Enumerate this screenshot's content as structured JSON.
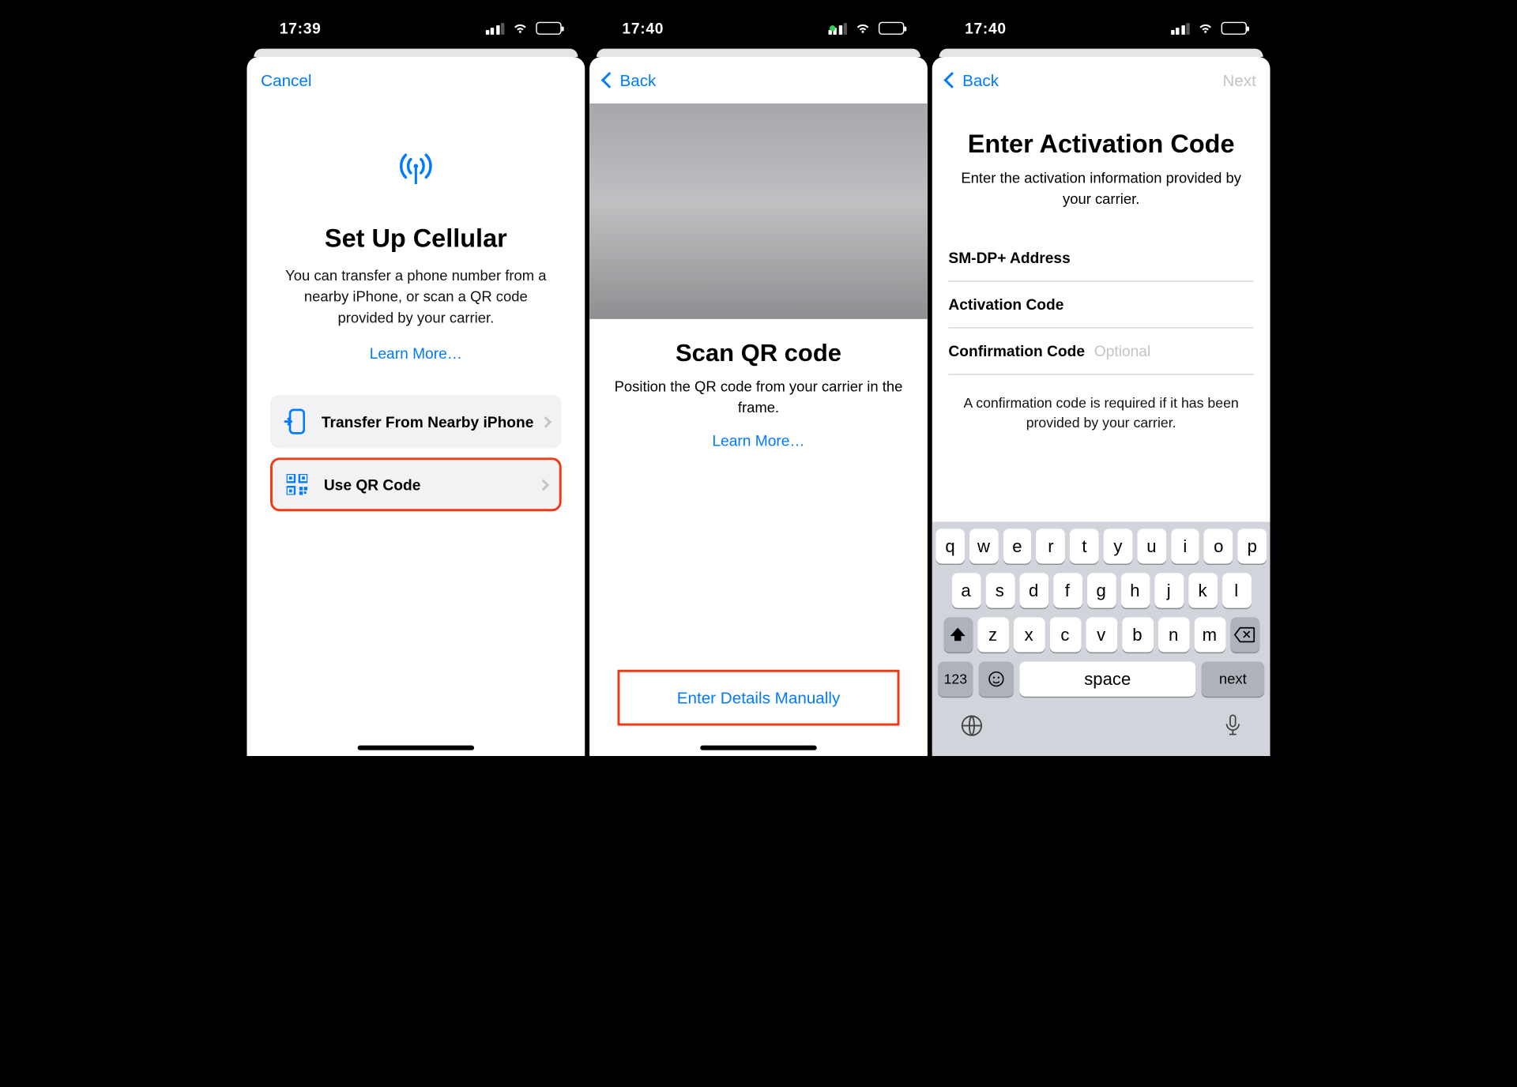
{
  "screen1": {
    "time": "17:39",
    "cancel": "Cancel",
    "title": "Set Up Cellular",
    "subtitle": "You can transfer a phone number from a nearby iPhone, or scan a QR code provided by your carrier.",
    "learn_more": "Learn More…",
    "option_transfer": "Transfer From Nearby iPhone",
    "option_qr": "Use QR Code"
  },
  "screen2": {
    "time": "17:40",
    "back": "Back",
    "title": "Scan QR code",
    "subtitle": "Position the QR code from your carrier in the frame.",
    "learn_more": "Learn More…",
    "manual": "Enter Details Manually"
  },
  "screen3": {
    "time": "17:40",
    "back": "Back",
    "next": "Next",
    "title": "Enter Activation Code",
    "subtitle": "Enter the activation information provided by your carrier.",
    "field1": "SM-DP+ Address",
    "field2": "Activation Code",
    "field3": "Confirmation Code",
    "field3_placeholder": "Optional",
    "hint": "A confirmation code is required if it has been provided by your carrier.",
    "kbd": {
      "row1": [
        "q",
        "w",
        "e",
        "r",
        "t",
        "y",
        "u",
        "i",
        "o",
        "p"
      ],
      "row2": [
        "a",
        "s",
        "d",
        "f",
        "g",
        "h",
        "j",
        "k",
        "l"
      ],
      "row3": [
        "z",
        "x",
        "c",
        "v",
        "b",
        "n",
        "m"
      ],
      "num": "123",
      "space": "space",
      "next": "next"
    }
  }
}
